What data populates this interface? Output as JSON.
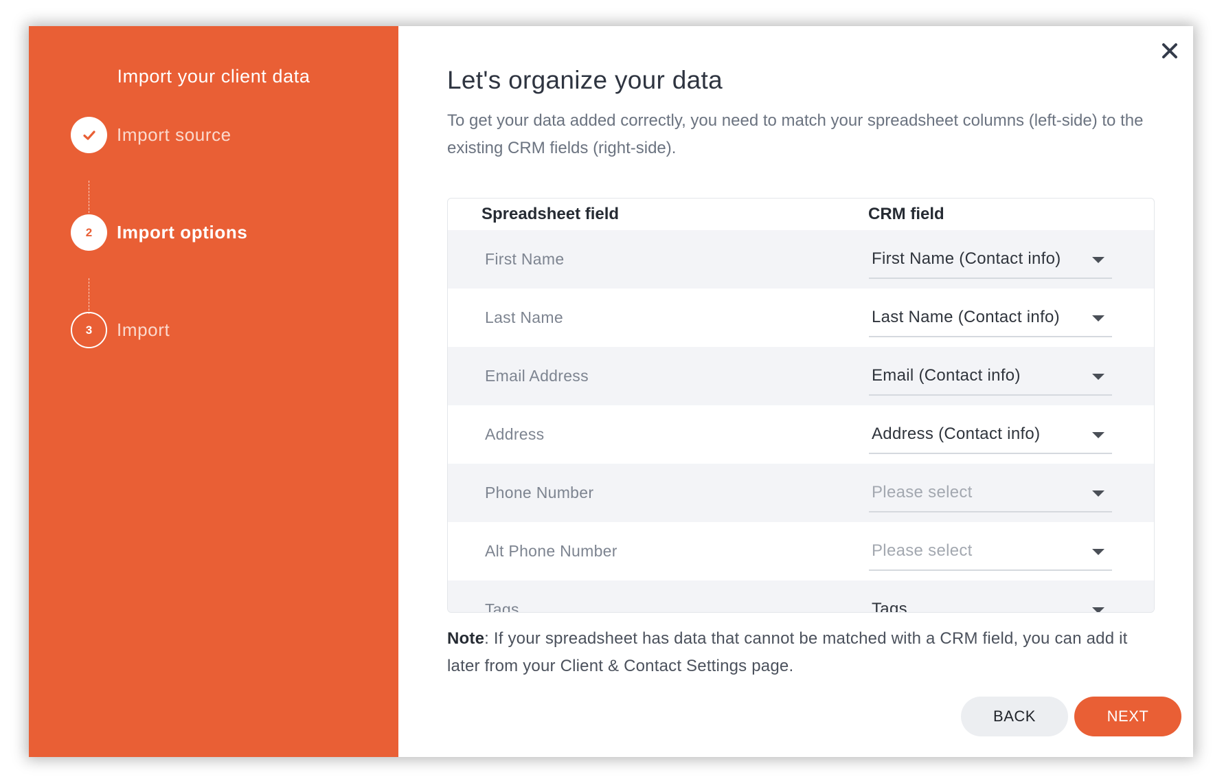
{
  "sidebar": {
    "title": "Import your client data",
    "steps": [
      {
        "number": "1",
        "label": "Import source",
        "state": "completed",
        "icon": "check-icon"
      },
      {
        "number": "2",
        "label": "Import options",
        "state": "active"
      },
      {
        "number": "3",
        "label": "Import",
        "state": "pending"
      }
    ]
  },
  "main": {
    "close_icon": "close-icon",
    "heading": "Let's organize your data",
    "description": "To get your data added correctly, you need to match your spreadsheet columns (left-side) to the existing CRM fields (right-side).",
    "table": {
      "headers": [
        "Spreadsheet field",
        "CRM field"
      ],
      "rows": [
        {
          "field": "First Name",
          "crm": "First Name (Contact info)",
          "placeholder": false
        },
        {
          "field": "Last Name",
          "crm": "Last Name (Contact info)",
          "placeholder": false
        },
        {
          "field": "Email Address",
          "crm": "Email (Contact info)",
          "placeholder": false
        },
        {
          "field": "Address",
          "crm": "Address (Contact info)",
          "placeholder": false
        },
        {
          "field": "Phone Number",
          "crm": "Please select",
          "placeholder": true
        },
        {
          "field": "Alt Phone Number",
          "crm": "Please select",
          "placeholder": true
        },
        {
          "field": "Tags",
          "crm": "Tags",
          "placeholder": false
        }
      ]
    },
    "note": {
      "label": "Note",
      "text": ": If your spreadsheet has data that cannot be matched with a CRM field, you can add it later from your Client & Contact Settings page."
    },
    "buttons": {
      "back": "BACK",
      "next": "NEXT"
    }
  },
  "colors": {
    "accent": "#e95f35",
    "row_shade": "#f3f4f7",
    "heading": "#2e3440"
  }
}
